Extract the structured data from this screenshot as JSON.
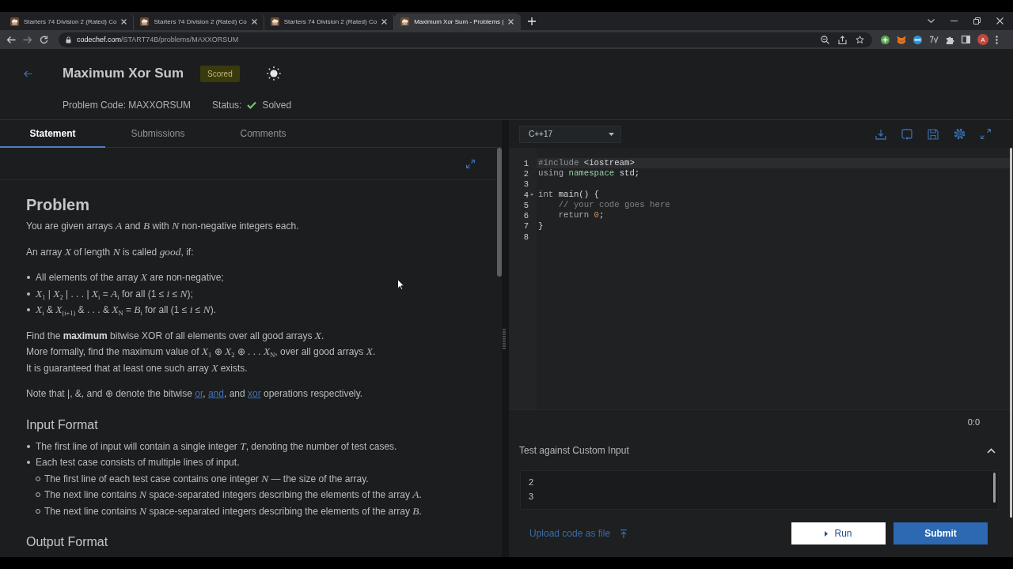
{
  "browser": {
    "tabs": [
      {
        "title": "Starters 74 Division 2 (Rated) Co",
        "selected": false
      },
      {
        "title": "Starters 74 Division 2 (Rated) Co",
        "selected": false
      },
      {
        "title": "Starters 74 Division 2 (Rated) Co",
        "selected": false
      },
      {
        "title": "Maximum Xor Sum - Problems |",
        "selected": true
      }
    ],
    "url": {
      "host": "codechef.com",
      "path": "/START74B/problems/MAXXORSUM"
    },
    "profile": "A"
  },
  "header": {
    "title": "Maximum Xor Sum",
    "badge": "Scored",
    "problem_code": "Problem Code: MAXXORSUM",
    "status_label": "Status:",
    "status": "Solved"
  },
  "tabs": [
    {
      "label": "Statement",
      "selected": true
    },
    {
      "label": "Submissions",
      "selected": false
    },
    {
      "label": "Comments",
      "selected": false
    }
  ],
  "statement": {
    "blocks": [
      {
        "kind": "title",
        "text": "Problem"
      },
      {
        "kind": "paragraph",
        "text": "You are given arrays *A* and *B* with *N* non-negative integers each."
      },
      {
        "kind": "paragraph",
        "text": "An array *X* of length *N* is called *good*, if:"
      },
      {
        "kind": "list",
        "items": [
          {
            "text": "All elements of the array *X* are non-negative;"
          },
          {
            "text": "*X*$_{1}$ | *X*$_{2}$ | . . . | *X*$_{i}$ = *A*$_{i}$ for all (1 ≤ *i* ≤ *N*);"
          },
          {
            "text": "*X*$_{i}$ & *X*$_{(i+1)}$ & . . . & *X*$_{N}$ = *B*$_{i}$ for all (1 ≤ *i* ≤ *N*)."
          }
        ]
      },
      {
        "kind": "lines",
        "lines": [
          "Find the **maximum** bitwise XOR of all elements over all good arrays *X*.",
          "More formally, find the maximum value of *X*$_{1}$ ⊕ *X*$_{2}$ ⊕ . . . *X*$_{N}$, over all good arrays *X*.",
          "It is guaranteed that at least one such array *X* exists."
        ]
      },
      {
        "kind": "note",
        "segments": [
          {
            "kind": "text",
            "text": "Note that |, &, and ⊕ denote the bitwise "
          },
          {
            "kind": "link",
            "text": "or"
          },
          {
            "kind": "text",
            "text": ", "
          },
          {
            "kind": "link",
            "text": "and"
          },
          {
            "kind": "text",
            "text": ", and "
          },
          {
            "kind": "link",
            "text": "xor"
          },
          {
            "kind": "text",
            "text": " operations respectively."
          }
        ]
      },
      {
        "kind": "heading",
        "text": "Input Format"
      },
      {
        "kind": "list",
        "items": [
          {
            "text": "The first line of input will contain a single integer *T*, denoting the number of test cases."
          },
          {
            "text": "Each test case consists of multiple lines of input.",
            "children": [
              {
                "text": "The first line of each test case contains one integer *N* — the size of the array."
              },
              {
                "text": "The next line contains *N* space-separated integers describing the elements of the array *A*."
              },
              {
                "text": "The next line contains *N* space-separated integers describing the elements of the array *B*."
              }
            ]
          }
        ]
      },
      {
        "kind": "heading",
        "text": "Output Format"
      }
    ]
  },
  "editor": {
    "language": "C++17",
    "lines": [
      {
        "number": "1",
        "current": true,
        "foldable": false,
        "tokens": [
          {
            "kind": "directive",
            "text": "#include"
          },
          {
            "kind": "plain",
            "text": " <iostream>"
          }
        ]
      },
      {
        "number": "2",
        "current": false,
        "foldable": false,
        "tokens": [
          {
            "kind": "keyword",
            "text": "using"
          },
          {
            "kind": "type",
            "text": " namespace"
          },
          {
            "kind": "plain",
            "text": " std;"
          }
        ]
      },
      {
        "number": "3",
        "current": false,
        "foldable": false
      },
      {
        "number": "4",
        "current": false,
        "foldable": true,
        "tokens": [
          {
            "kind": "keyword",
            "text": "int"
          },
          {
            "kind": "plain",
            "text": " main() {"
          }
        ]
      },
      {
        "number": "5",
        "current": false,
        "foldable": false,
        "tokens": [
          {
            "kind": "comment",
            "text": "    // your code goes here"
          }
        ]
      },
      {
        "number": "6",
        "current": false,
        "foldable": false,
        "tokens": [
          {
            "kind": "keyword",
            "text": "    return"
          },
          {
            "kind": "number",
            "text": " 0"
          },
          {
            "kind": "plain",
            "text": ";"
          }
        ]
      },
      {
        "number": "7",
        "current": false,
        "foldable": false,
        "tokens": [
          {
            "kind": "plain",
            "text": "}"
          }
        ]
      },
      {
        "number": "8",
        "current": false,
        "foldable": false
      }
    ],
    "cursor": "0:0"
  },
  "custom_input": {
    "title": "Test against Custom Input",
    "expanded": true,
    "lines": [
      "2",
      "3"
    ]
  },
  "actions": {
    "upload": "Upload code as file",
    "run": "Run",
    "submit": "Submit"
  }
}
